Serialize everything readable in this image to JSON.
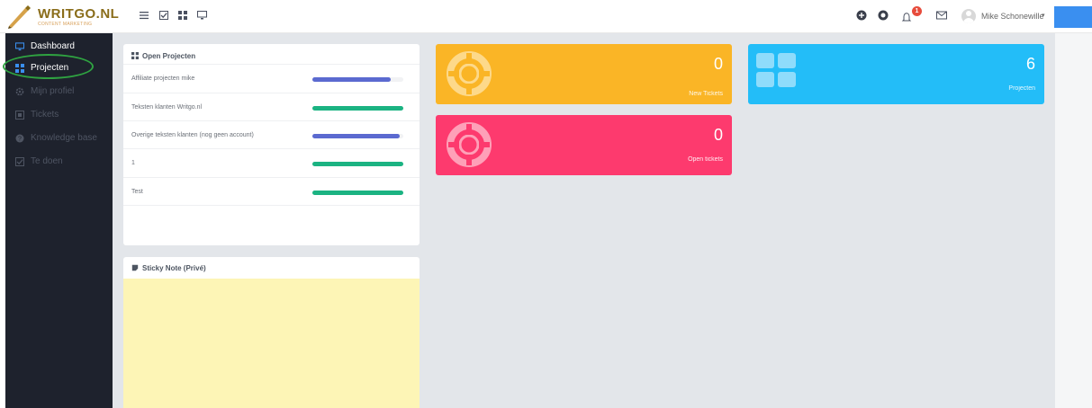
{
  "brand": {
    "name": "WRITGO.NL",
    "tagline": "CONTENT MARKETING",
    "accent": "#8a6d1a"
  },
  "topbar": {
    "icons": [
      "list-icon",
      "check-icon",
      "grid-icon",
      "monitor-icon"
    ],
    "notifications_count": "1",
    "user_name": "Mike Schonewille",
    "user_caret": "▾"
  },
  "sidebar": {
    "items": [
      {
        "label": "Dashboard",
        "icon": "monitor-icon",
        "state": "active"
      },
      {
        "label": "Projecten",
        "icon": "grid-icon",
        "state": "active"
      },
      {
        "label": "Mijn profiel",
        "icon": "gear-icon",
        "state": "dim"
      },
      {
        "label": "Tickets",
        "icon": "ticket-icon",
        "state": "dim"
      },
      {
        "label": "Knowledge base",
        "icon": "question-icon",
        "state": "dim"
      },
      {
        "label": "Te doen",
        "icon": "check-icon",
        "state": "dim"
      }
    ]
  },
  "open_projects": {
    "title": "Open Projecten",
    "rows": [
      {
        "name": "Affiliate projecten mike",
        "progress": 0.86,
        "color": "#5b6ad0"
      },
      {
        "name": "Teksten klanten Writgo.nl",
        "progress": 1.0,
        "color": "#1bb382"
      },
      {
        "name": "Overige teksten klanten (nog geen account)",
        "progress": 0.96,
        "color": "#5b6ad0"
      },
      {
        "name": "1",
        "progress": 1.0,
        "color": "#1bb382"
      },
      {
        "name": "Test",
        "progress": 1.0,
        "color": "#1bb382"
      }
    ]
  },
  "sticky_note": {
    "title": "Sticky Note (Privé)",
    "color": "#fdf5b6"
  },
  "stats": {
    "new_tickets": {
      "value": "0",
      "label": "New Tickets",
      "color": "#fab526"
    },
    "open_tickets": {
      "value": "0",
      "label": "Open tickets",
      "color": "#fd3a6e"
    },
    "projects": {
      "value": "6",
      "label": "Projecten",
      "color": "#23bdf8"
    }
  }
}
